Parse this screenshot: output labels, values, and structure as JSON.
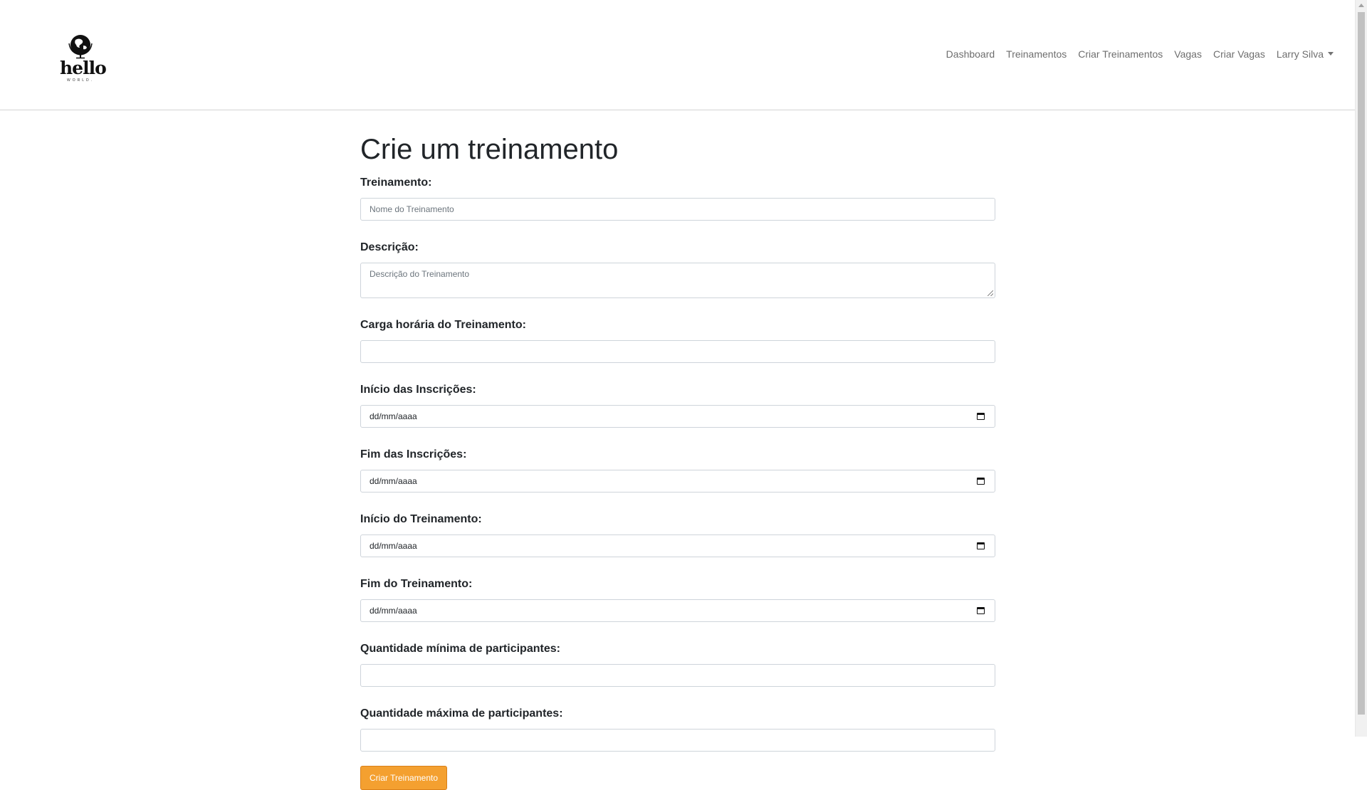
{
  "brand": {
    "name": "hello",
    "tagline": "WORLD."
  },
  "nav": {
    "items": [
      {
        "label": "Dashboard"
      },
      {
        "label": "Treinamentos"
      },
      {
        "label": "Criar Treinamentos"
      },
      {
        "label": "Vagas"
      },
      {
        "label": "Criar Vagas"
      }
    ],
    "user": {
      "label": "Larry Silva"
    }
  },
  "page": {
    "title": "Crie um treinamento"
  },
  "form": {
    "fields": [
      {
        "label": "Treinamento:",
        "placeholder": "Nome do Treinamento",
        "type": "text"
      },
      {
        "label": "Descrição:",
        "placeholder": "Descrição do Treinamento",
        "type": "textarea"
      },
      {
        "label": "Carga horária do Treinamento:",
        "placeholder": "",
        "type": "number"
      },
      {
        "label": "Início das Inscrições:",
        "placeholder": "dd/mm/aaaa",
        "type": "date"
      },
      {
        "label": "Fim das Inscrições:",
        "placeholder": "dd/mm/aaaa",
        "type": "date"
      },
      {
        "label": "Início do Treinamento:",
        "placeholder": "dd/mm/aaaa",
        "type": "date"
      },
      {
        "label": "Fim do Treinamento:",
        "placeholder": "dd/mm/aaaa",
        "type": "date"
      },
      {
        "label": "Quantidade mínima de participantes:",
        "placeholder": "",
        "type": "number"
      },
      {
        "label": "Quantidade máxima de participantes:",
        "placeholder": "",
        "type": "number"
      }
    ],
    "submit_label": "Criar Treinamento"
  },
  "colors": {
    "accent": "#f4a030",
    "loading_bar": "#1a73e8"
  },
  "loading_progress": 0.2
}
